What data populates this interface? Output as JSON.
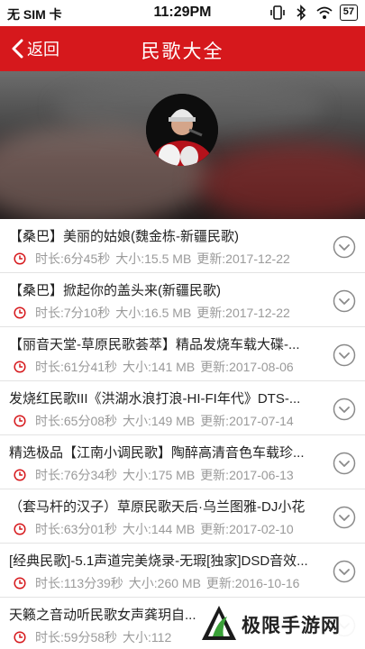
{
  "status_bar": {
    "carrier": "无 SIM 卡",
    "time": "11:29PM",
    "battery": "57",
    "icons": [
      "vibrate-icon",
      "bluetooth-icon",
      "wifi-icon"
    ]
  },
  "nav": {
    "back_label": "返回",
    "title": "民歌大全",
    "bar_color": "#d6181c"
  },
  "songs": [
    {
      "title": "【桑巴】美丽的姑娘(魏金栋-新疆民歌)",
      "duration": "时长:6分45秒",
      "size": "大小:15.5 MB",
      "updated": "更新:2017-12-22"
    },
    {
      "title": "【桑巴】掀起你的盖头来(新疆民歌)",
      "duration": "时长:7分10秒",
      "size": "大小:16.5 MB",
      "updated": "更新:2017-12-22"
    },
    {
      "title": "【丽音天堂-草原民歌荟萃】精品发烧车载大碟-...",
      "duration": "时长:61分41秒",
      "size": "大小:141 MB",
      "updated": "更新:2017-08-06"
    },
    {
      "title": "发烧红民歌III《洪湖水浪打浪-HI-FI年代》DTS-...",
      "duration": "时长:65分08秒",
      "size": "大小:149 MB",
      "updated": "更新:2017-07-14"
    },
    {
      "title": "精选极品【江南小调民歌】陶醉高清音色车载珍...",
      "duration": "时长:76分34秒",
      "size": "大小:175 MB",
      "updated": "更新:2017-06-13"
    },
    {
      "title": "（套马杆的汉子）草原民歌天后·乌兰图雅-DJ小花",
      "duration": "时长:63分01秒",
      "size": "大小:144 MB",
      "updated": "更新:2017-02-10"
    },
    {
      "title": "[经典民歌]-5.1声道完美烧录-无瑕[独家]DSD音效...",
      "duration": "时长:113分39秒",
      "size": "大小:260 MB",
      "updated": "更新:2016-10-16"
    },
    {
      "title": "天籁之音动听民歌女声龚玥自...",
      "duration": "时长:59分58秒",
      "size": "大小:112",
      "updated": ""
    }
  ],
  "watermark": {
    "text": "极限手游网"
  }
}
